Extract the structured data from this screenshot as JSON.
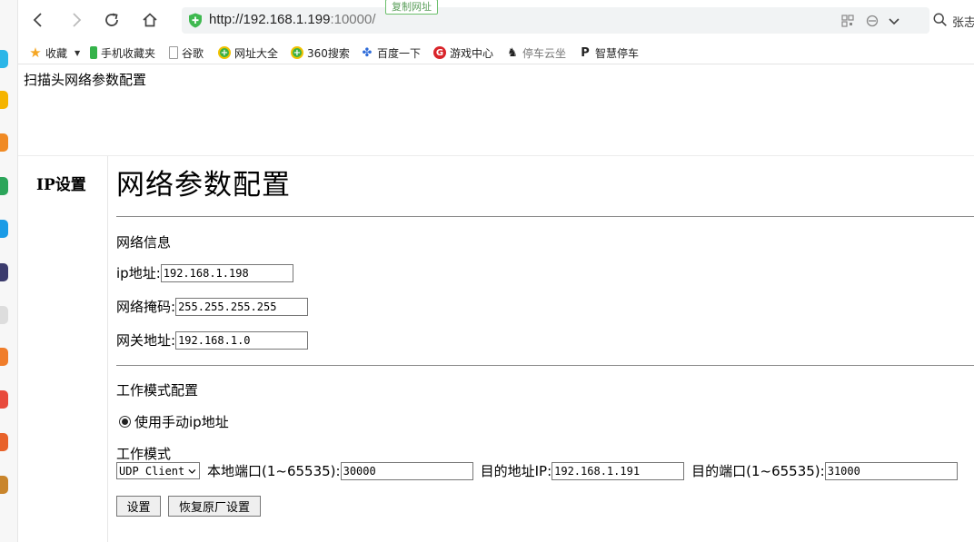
{
  "browser": {
    "url_host": "http://192.168.1.199",
    "url_port": ":10000/",
    "copy_tag": "复制网址",
    "search_label": "张志"
  },
  "bookmarks": [
    {
      "label": "收藏",
      "icon": "star-icon",
      "color": "#f5a623"
    },
    {
      "label": "手机收藏夹",
      "icon": "phone-icon",
      "color": "#35b34a"
    },
    {
      "label": "谷歌",
      "icon": "page-icon",
      "color": "#999999"
    },
    {
      "label": "网址大全",
      "icon": "360-icon",
      "color": "#3cb043"
    },
    {
      "label": "360搜索",
      "icon": "360-icon",
      "color": "#3cb043"
    },
    {
      "label": "百度一下",
      "icon": "baidu-paw-icon",
      "color": "#2e6bd9"
    },
    {
      "label": "游戏中心",
      "icon": "game-icon",
      "color": "#d9242a"
    },
    {
      "label": "停车云坐",
      "icon": "horse-icon",
      "color": "#222222"
    },
    {
      "label": "智慧停车",
      "icon": "parking-icon",
      "color": "#222222"
    }
  ],
  "page": {
    "header": "扫描头网络参数配置",
    "sidebar_item": "IP设置",
    "title": "网络参数配置"
  },
  "network": {
    "section_title": "网络信息",
    "ip_label": "ip地址:",
    "ip_value": "192.168.1.198",
    "mask_label": "网络掩码:",
    "mask_value": "255.255.255.255",
    "gateway_label": "网关地址:",
    "gateway_value": "192.168.1.0"
  },
  "work": {
    "section_title": "工作模式配置",
    "radio_label": "使用手动ip地址",
    "mode_label": "工作模式",
    "mode_value": "UDP Client",
    "local_port_label": "本地端口(1~65535):",
    "local_port_value": "30000",
    "dest_ip_label": "目的地址IP:",
    "dest_ip_value": "192.168.1.191",
    "dest_port_label": "目的端口(1~65535):",
    "dest_port_value": "31000"
  },
  "buttons": {
    "set": "设置",
    "reset": "恢复原厂设置"
  }
}
